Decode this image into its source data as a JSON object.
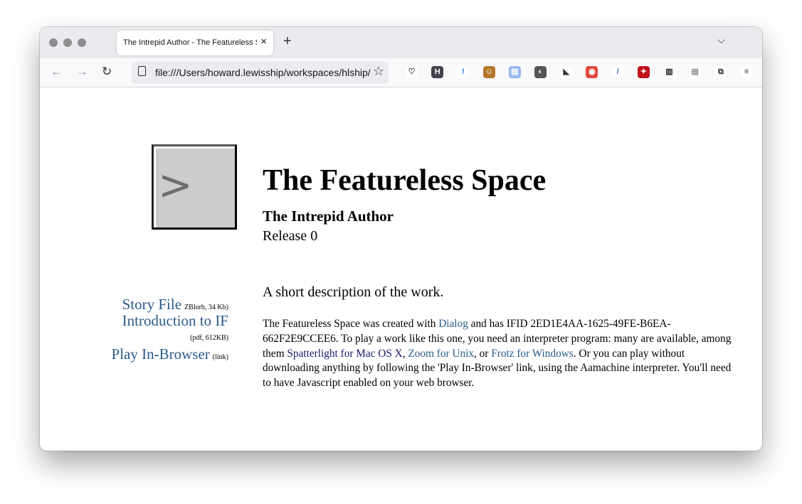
{
  "browser": {
    "tab_title": "The Intrepid Author - The Featureless Space",
    "url": "file:///Users/howard.lewisship/workspaces/hlship/",
    "extensions": [
      {
        "name": "pocket-icon",
        "color": "#ffffff",
        "fg": "#333",
        "glyph": "♡"
      },
      {
        "name": "h-extension-icon",
        "color": "#42414d",
        "fg": "#fff",
        "glyph": "H"
      },
      {
        "name": "password-lock-icon",
        "color": "#ffffff",
        "fg": "#1a73e8",
        "glyph": "!"
      },
      {
        "name": "monkey-icon",
        "color": "#b5762b",
        "fg": "#fff",
        "glyph": "☺"
      },
      {
        "name": "documents-icon",
        "color": "#9ab8f0",
        "fg": "#fff",
        "glyph": "▤"
      },
      {
        "name": "privacy-icon",
        "color": "#555555",
        "fg": "#fff",
        "glyph": "◐"
      },
      {
        "name": "raccoon-icon",
        "color": "#ffffff",
        "fg": "#333",
        "glyph": "◣"
      },
      {
        "name": "camera-icon",
        "color": "#e0483e",
        "fg": "#fff",
        "glyph": "◉"
      },
      {
        "name": "eyedropper-icon",
        "color": "#ffffff",
        "fg": "#3c6fc4",
        "glyph": "/"
      },
      {
        "name": "magic-wand-icon",
        "color": "#c0121a",
        "fg": "#fff",
        "glyph": "✦"
      },
      {
        "name": "reader-stack-icon",
        "color": "#ffffff",
        "fg": "#222",
        "glyph": "▥"
      },
      {
        "name": "reader-view-icon",
        "color": "#ffffff",
        "fg": "#888",
        "glyph": "▤"
      },
      {
        "name": "extensions-icon",
        "color": "#ffffff",
        "fg": "#333",
        "glyph": "⧉"
      },
      {
        "name": "menu-icon",
        "color": "#ffffff",
        "fg": "#333",
        "glyph": "≡"
      }
    ]
  },
  "page": {
    "cover_glyph": ">",
    "title": "The Featureless Space",
    "author": "The Intrepid Author",
    "release": "Release 0",
    "short_description": "A short description of the work.",
    "links": [
      {
        "label": "Story File",
        "note": "ZBlorb, 34 Kb)"
      },
      {
        "label": "Introduction to IF",
        "note": "(pdf, 612KB)"
      },
      {
        "label": "Play In-Browser",
        "note": "(link)"
      }
    ],
    "body": {
      "t1": "The Featureless Space was created with ",
      "dialog": "Dialog",
      "t2": " and has IFID 2ED1E4AA-1625-49FE-B6EA-662F2E9CCEE6. To play a work like this one, you need an interpreter program: many are available, among them ",
      "spatterlight": "Spatterlight for Mac OS X",
      "t3": ", ",
      "zoom": "Zoom for Unix",
      "t4": ", or ",
      "frotz": "Frotz for Windows",
      "t5": ". Or you can play without downloading anything by following the 'Play In-Browser' link, using the Aamachine interpreter. You'll need to have Javascript enabled on your web browser."
    }
  }
}
